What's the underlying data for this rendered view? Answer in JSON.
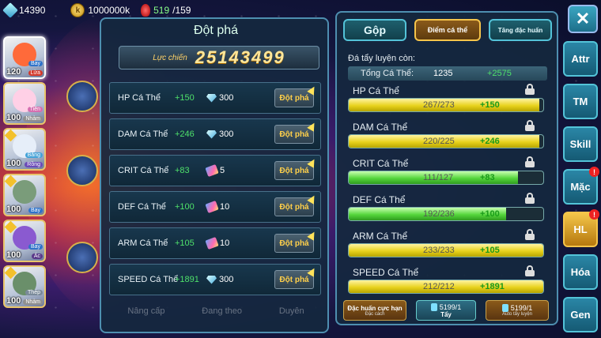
{
  "resources": {
    "gems": "14390",
    "coin_icon": "k",
    "gold": "1000000k",
    "stamina_current": "519",
    "stamina_max": "/159"
  },
  "heroes": [
    {
      "level": "120",
      "tag1": "Bay",
      "tag2": "Lửa",
      "color": "#ff6a3a"
    },
    {
      "level": "100",
      "tag1": "Tiên",
      "tag2": "Nhảm",
      "color": "#ffd0e6"
    },
    {
      "level": "100",
      "tag1": "Băng",
      "tag2": "Rồng",
      "color": "#e6eef9"
    },
    {
      "level": "100",
      "tag1": "Bay",
      "tag2": "",
      "color": "#7a9c7a"
    },
    {
      "level": "100",
      "tag1": "Bay",
      "tag2": "Ác",
      "color": "#8a5ad0"
    },
    {
      "level": "100",
      "tag1": "Thép",
      "tag2": "Nhảm",
      "color": "#6a8f6a"
    }
  ],
  "left_panel": {
    "title": "Đột phá",
    "power_label": "Lực chiến",
    "power_value": "25143499",
    "break_label": "Đột phá",
    "rows": [
      {
        "name": "HP Cá Thể",
        "gain": "+150",
        "cost_icon": "diamond",
        "cost": "300"
      },
      {
        "name": "DAM Cá Thể",
        "gain": "+246",
        "cost_icon": "diamond",
        "cost": "300"
      },
      {
        "name": "CRIT Cá Thể",
        "gain": "+83",
        "cost_icon": "scroll",
        "cost": "5"
      },
      {
        "name": "DEF Cá Thể",
        "gain": "+100",
        "cost_icon": "scroll",
        "cost": "10"
      },
      {
        "name": "ARM Cá Thể",
        "gain": "+105",
        "cost_icon": "scroll",
        "cost": "10"
      },
      {
        "name": "SPEED Cá Thể",
        "gain": "+1891",
        "cost_icon": "diamond",
        "cost": "300"
      }
    ],
    "bottom_tabs": [
      "Nâng cấp",
      "Đang theo",
      "Duyên"
    ]
  },
  "right_panel": {
    "tabs": [
      "Gộp",
      "Điểm cá thể",
      "Tăng đặc huấn"
    ],
    "remain_label": "Đá tẩy luyện còn:",
    "total_label": "Tổng Cá Thể:",
    "total_value": "1235",
    "total_bonus": "+2575",
    "traits": [
      {
        "name": "HP Cá Thể",
        "value": "267/273",
        "gain": "+150",
        "fill": 0.98,
        "green": false
      },
      {
        "name": "DAM Cá Thể",
        "value": "220/225",
        "gain": "+246",
        "fill": 0.98,
        "green": false
      },
      {
        "name": "CRIT Cá Thể",
        "value": "111/127",
        "gain": "+83",
        "fill": 0.87,
        "green": true
      },
      {
        "name": "DEF Cá Thể",
        "value": "192/236",
        "gain": "+100",
        "fill": 0.81,
        "green": true
      },
      {
        "name": "ARM Cá Thể",
        "value": "233/233",
        "gain": "+105",
        "fill": 1.0,
        "green": false
      },
      {
        "name": "SPEED Cá Thể",
        "value": "212/212",
        "gain": "+1891",
        "fill": 1.0,
        "green": false
      }
    ],
    "btn_special": "Đặc huấn cực hạn",
    "btn_special_sub": "Đặc cách",
    "btn_wash_count": "5199/1",
    "btn_wash": "Tẩy",
    "btn_auto_count": "5199/1",
    "btn_auto": "Auto tẩy luyện"
  },
  "side_menu": {
    "close": "✕",
    "items": [
      {
        "label": "Attr",
        "alert": false,
        "gold": false
      },
      {
        "label": "TM",
        "alert": false,
        "gold": false
      },
      {
        "label": "Skill",
        "alert": false,
        "gold": false
      },
      {
        "label": "Mặc",
        "alert": true,
        "gold": false
      },
      {
        "label": "HL",
        "alert": true,
        "gold": true
      },
      {
        "label": "Hóa",
        "alert": false,
        "gold": false
      },
      {
        "label": "Gen",
        "alert": false,
        "gold": false
      }
    ],
    "alert_mark": "!"
  }
}
